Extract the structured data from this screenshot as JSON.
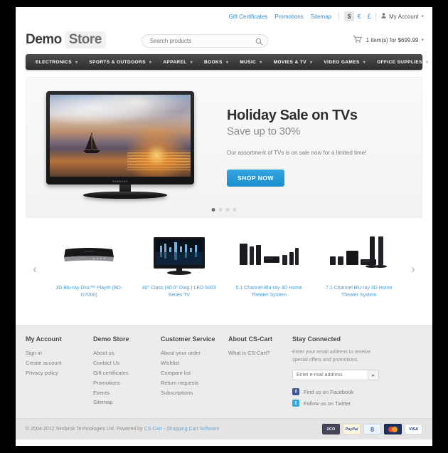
{
  "topbar": {
    "links": [
      "Gift Certificates",
      "Promotions",
      "Sitemap"
    ],
    "currencies": [
      {
        "symbol": "$",
        "active": true
      },
      {
        "symbol": "€",
        "active": false
      },
      {
        "symbol": "£",
        "active": false
      }
    ],
    "account_label": "My Account",
    "account_icon": "user-icon",
    "caret_icon": "chevron-down-icon"
  },
  "header": {
    "logo_primary": "Demo",
    "logo_secondary": "Store",
    "search_placeholder": "Search products",
    "search_value": "",
    "search_icon": "search-icon",
    "cart_icon": "cart-icon",
    "cart_text": "1 item(s) for $699.99",
    "cart_caret": "chevron-down-icon"
  },
  "nav": {
    "items": [
      "ELECTRONICS",
      "SPORTS & OUTDOORS",
      "APPAREL",
      "BOOKS",
      "MUSIC",
      "MOVIES & TV",
      "VIDEO GAMES",
      "OFFICE SUPPLIES"
    ],
    "caret_icon": "chevron-down-icon"
  },
  "hero": {
    "title": "Holiday Sale on TVs",
    "subtitle": "Save up to 30%",
    "body": "Our assortment of TVs is on sale now for a limited time!",
    "cta_label": "SHOP NOW",
    "image_alt": "samsung-flat-screen-tv-sunset-sailboat",
    "tv_brand": "SAMSUNG",
    "dots": 4,
    "active_dot": 0
  },
  "carousel": {
    "prev_icon": "chevron-left-icon",
    "next_icon": "chevron-right-icon",
    "products": [
      {
        "title": "3D Blu-ray Disc™ Player (BD-D7000)",
        "image_alt": "blu-ray-player"
      },
      {
        "title": "40\" Class (40.0\" Diag.) LED 5003 Series TV",
        "image_alt": "led-tv"
      },
      {
        "title": "5.1 Channel Blu-ray 3D Home Theater System",
        "image_alt": "home-theater-5-1"
      },
      {
        "title": "7.1 Channel Blu-ray 3D Home Theater System",
        "image_alt": "home-theater-7-1"
      }
    ]
  },
  "footer": {
    "columns": [
      {
        "title": "My Account",
        "items": [
          "Sign in",
          "Create account",
          "Privacy policy"
        ]
      },
      {
        "title": "Demo Store",
        "items": [
          "About us",
          "Contact Us",
          "Gift certificates",
          "Promotions",
          "Events",
          "Sitemap"
        ]
      },
      {
        "title": "Customer Service",
        "items": [
          "About your order",
          "Wishlist",
          "Compare list",
          "Return requests",
          "Subscriptions"
        ]
      },
      {
        "title": "About CS-Cart",
        "items": [
          "What is CS-Cart?"
        ]
      }
    ],
    "stay": {
      "title": "Stay Connected",
      "description": "Enter your email address to receive special offers and promotions.",
      "newsletter_placeholder": "Enter e-mail address",
      "newsletter_value": "",
      "submit_icon": "arrow-right-icon",
      "social": [
        {
          "label": "Find us on Facebook",
          "icon": "facebook-icon",
          "glyph": "f"
        },
        {
          "label": "Follow us on Twitter",
          "icon": "twitter-icon",
          "glyph": "t"
        }
      ]
    }
  },
  "copyright": {
    "text": "© 2004-2012 Simbirsk Technologies Ltd.  Powered by ",
    "link": "CS-Cart - Shopping Cart Software",
    "payments": [
      {
        "name": "2co-badge",
        "label": "2CO"
      },
      {
        "name": "paypal-badge",
        "label": "PayPal"
      },
      {
        "name": "google-checkout-badge",
        "label": "8"
      },
      {
        "name": "mastercard-badge",
        "label": ""
      },
      {
        "name": "visa-badge",
        "label": "VISA"
      }
    ]
  },
  "colors": {
    "accent_blue": "#3a8bc9",
    "cta_blue": "#1a8dcd",
    "nav_dark": "#2d2d2d",
    "footer_gray": "#ececec"
  }
}
